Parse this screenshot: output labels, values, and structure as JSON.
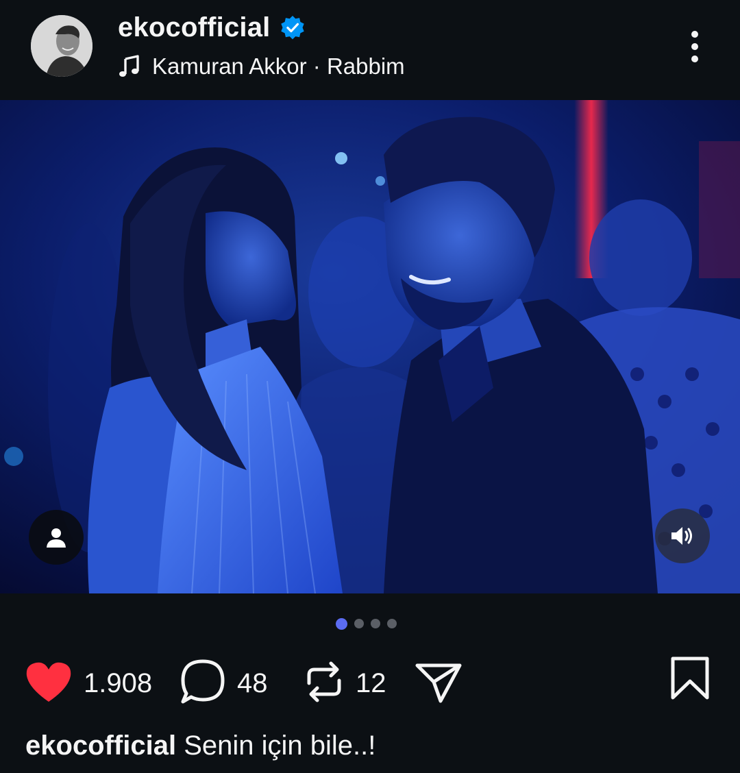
{
  "post": {
    "username": "ekocofficial",
    "verified": true,
    "music": {
      "artist": "Kamuran Akkor",
      "separator": "·",
      "song": "Rabbim"
    },
    "icons": {
      "more": "more-vertical-icon",
      "tag": "user-tag-icon",
      "sound": "volume-on-icon",
      "like": "heart-filled-icon",
      "comment": "comment-icon",
      "repost": "repost-icon",
      "share": "send-icon",
      "save": "bookmark-icon"
    },
    "carousel": {
      "total": 4,
      "active": 1
    },
    "stats": {
      "likes": "1.908",
      "comments": "48",
      "reposts": "12"
    },
    "caption": {
      "username": "ekocofficial",
      "text": "Senin için bile..!"
    }
  },
  "colors": {
    "background": "#0c1014",
    "like": "#ff3040",
    "verified": "#0095f6",
    "active_dot": "#5b6cf2"
  }
}
